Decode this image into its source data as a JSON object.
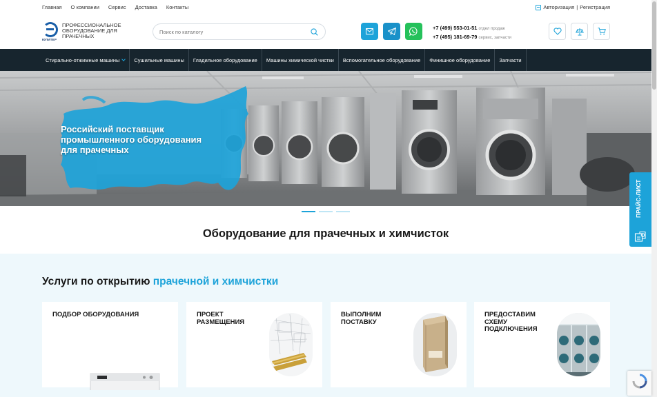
{
  "topbar": {
    "nav": [
      "Главная",
      "О компании",
      "Сервис",
      "Доставка",
      "Контакты"
    ],
    "login": "Авторизация",
    "separator": "|",
    "register": "Регистрация"
  },
  "header": {
    "logo_word": "ЮПИТЕР",
    "logo_text": "Профессиональное оборудование для прачечных",
    "search_placeholder": "Поиск по каталогу",
    "phone1": "+7 (499) 553-01-51",
    "phone1_note": "отдел продаж",
    "phone2": "+7 (495) 181-69-79",
    "phone2_note": "сервис, запчасти"
  },
  "main_nav": [
    "Стирально-отжимные машины",
    "Сушильные машины",
    "Гладильное оборудование",
    "Машины химической чистки",
    "Вспомогательное оборудование",
    "Финишное оборудование",
    "Запчасти"
  ],
  "hero": {
    "title": "Российский поставщик промышленного оборудования для прачечных",
    "slides": 3,
    "active_slide": 1
  },
  "section_title": "Оборудование для прачечных и химчисток",
  "services": {
    "title_plain": "Услуги по открытию ",
    "title_accent": "прачечной и химчистки",
    "cards": [
      {
        "label": "Подбор оборудования"
      },
      {
        "label": "Проект размещения"
      },
      {
        "label": "Выполним поставку"
      },
      {
        "label": "Предоставим схему подключения"
      }
    ]
  },
  "price_tab": "ПРАЙС-ЛИСТ",
  "colors": {
    "accent": "#1da3d9",
    "nav_bg": "#17252e",
    "telegram": "#1a91c9",
    "whatsapp": "#25c15b",
    "services_bg": "#eef8fc"
  }
}
